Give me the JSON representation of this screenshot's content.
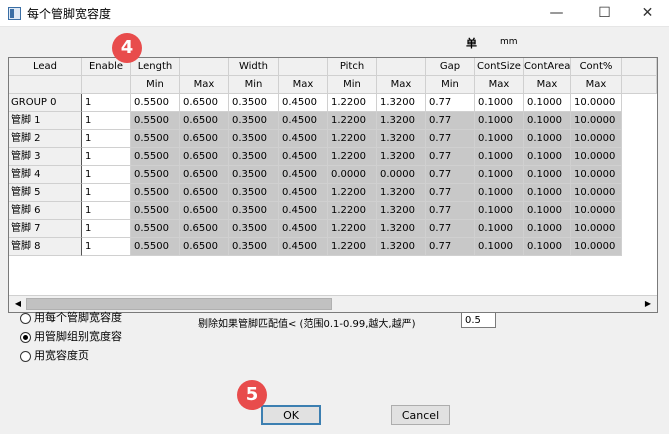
{
  "window": {
    "title": "每个管脚宽容度",
    "controls": [
      "minimize-icon",
      "maximize-icon",
      "close-icon"
    ],
    "min_glyph": "—",
    "max_glyph": "☐",
    "close_glyph": "✕"
  },
  "unit": {
    "label": "单",
    "value": "mm"
  },
  "table": {
    "header_top": [
      "Lead",
      "Enable",
      "Length",
      "",
      "Width",
      "",
      "Pitch",
      "",
      "Gap",
      "ContSize",
      "ContArea",
      "Cont%"
    ],
    "header_sub": [
      "",
      "",
      "Min",
      "Max",
      "Min",
      "Max",
      "Min",
      "Max",
      "Min",
      "Max",
      "Max",
      "Max"
    ],
    "rows": [
      [
        "GROUP 0",
        "1",
        "0.5500",
        "0.6500",
        "0.3500",
        "0.4500",
        "1.2200",
        "1.3200",
        "0.77",
        "0.1000",
        "0.1000",
        "10.0000"
      ],
      [
        "管脚 1",
        "1",
        "0.5500",
        "0.6500",
        "0.3500",
        "0.4500",
        "1.2200",
        "1.3200",
        "0.77",
        "0.1000",
        "0.1000",
        "10.0000"
      ],
      [
        "管脚 2",
        "1",
        "0.5500",
        "0.6500",
        "0.3500",
        "0.4500",
        "1.2200",
        "1.3200",
        "0.77",
        "0.1000",
        "0.1000",
        "10.0000"
      ],
      [
        "管脚 3",
        "1",
        "0.5500",
        "0.6500",
        "0.3500",
        "0.4500",
        "1.2200",
        "1.3200",
        "0.77",
        "0.1000",
        "0.1000",
        "10.0000"
      ],
      [
        "管脚 4",
        "1",
        "0.5500",
        "0.6500",
        "0.3500",
        "0.4500",
        "0.0000",
        "0.0000",
        "0.77",
        "0.1000",
        "0.1000",
        "10.0000"
      ],
      [
        "管脚 5",
        "1",
        "0.5500",
        "0.6500",
        "0.3500",
        "0.4500",
        "1.2200",
        "1.3200",
        "0.77",
        "0.1000",
        "0.1000",
        "10.0000"
      ],
      [
        "管脚 6",
        "1",
        "0.5500",
        "0.6500",
        "0.3500",
        "0.4500",
        "1.2200",
        "1.3200",
        "0.77",
        "0.1000",
        "0.1000",
        "10.0000"
      ],
      [
        "管脚 7",
        "1",
        "0.5500",
        "0.6500",
        "0.3500",
        "0.4500",
        "1.2200",
        "1.3200",
        "0.77",
        "0.1000",
        "0.1000",
        "10.0000"
      ],
      [
        "管脚 8",
        "1",
        "0.5500",
        "0.6500",
        "0.3500",
        "0.4500",
        "1.2200",
        "1.3200",
        "0.77",
        "0.1000",
        "0.1000",
        "10.0000"
      ]
    ],
    "scroll_left_glyph": "◀",
    "scroll_right_glyph": "▶"
  },
  "options": {
    "radios": [
      {
        "label": "用每个管脚宽容度",
        "selected": false
      },
      {
        "label": "用管脚组别宽度容",
        "selected": true
      },
      {
        "label": "用宽容度页",
        "selected": false
      }
    ],
    "exclude_label": "剔除如果管脚匹配值< (范围0.1-0.99,越大,越严)",
    "exclude_value": "0.5"
  },
  "markers": {
    "step4": "4",
    "step5": "5"
  },
  "buttons": {
    "ok": "OK",
    "cancel": "Cancel"
  },
  "colors": {
    "marker": "#e84c4c",
    "row_gray": "#c8c8c8",
    "ok_border": "#3c7fb1"
  }
}
